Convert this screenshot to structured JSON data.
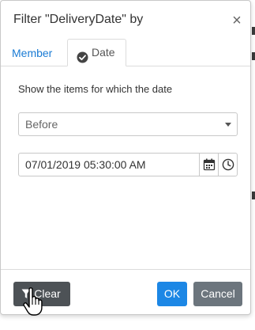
{
  "dialog": {
    "title": "Filter \"DeliveryDate\" by",
    "close_label": "×"
  },
  "tabs": [
    {
      "label": "Member",
      "active": false
    },
    {
      "label": "Date",
      "active": true,
      "icon": "check-circle-icon"
    }
  ],
  "date_filter": {
    "instruction": "Show the items for which the date",
    "condition": "Before",
    "value": "07/01/2019 05:30:00 AM",
    "calendar_icon": "calendar-icon",
    "clock_icon": "clock-icon"
  },
  "footer": {
    "clear_label": "Clear",
    "clear_icon": "filter-icon",
    "ok_label": "OK",
    "cancel_label": "Cancel"
  },
  "colors": {
    "accent": "#1c87e5",
    "tab_link": "#1a7bd4",
    "clear_button": "#4d5256",
    "cancel_button": "#6c757d"
  }
}
